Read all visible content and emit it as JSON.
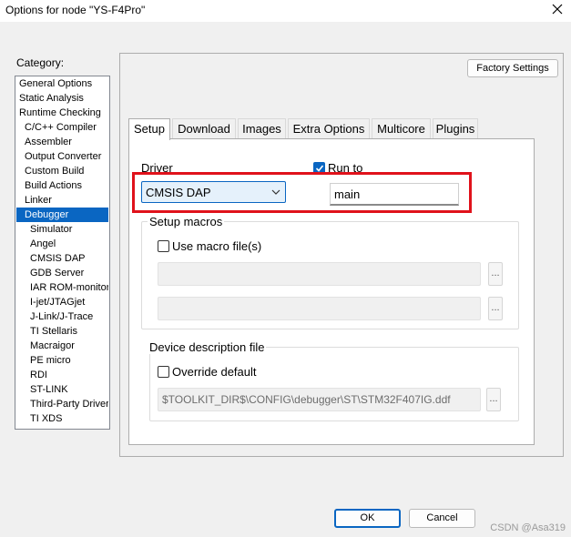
{
  "window": {
    "title": "Options for node \"YS-F4Pro\""
  },
  "category": {
    "label": "Category:",
    "items": [
      {
        "label": "General Options",
        "level": 0
      },
      {
        "label": "Static Analysis",
        "level": 0
      },
      {
        "label": "Runtime Checking",
        "level": 0
      },
      {
        "label": "C/C++ Compiler",
        "level": 1
      },
      {
        "label": "Assembler",
        "level": 1
      },
      {
        "label": "Output Converter",
        "level": 1
      },
      {
        "label": "Custom Build",
        "level": 1
      },
      {
        "label": "Build Actions",
        "level": 1
      },
      {
        "label": "Linker",
        "level": 1
      },
      {
        "label": "Debugger",
        "level": 1,
        "selected": true
      },
      {
        "label": "Simulator",
        "level": 2
      },
      {
        "label": "Angel",
        "level": 2
      },
      {
        "label": "CMSIS DAP",
        "level": 2
      },
      {
        "label": "GDB Server",
        "level": 2
      },
      {
        "label": "IAR ROM-monitor",
        "level": 2
      },
      {
        "label": "I-jet/JTAGjet",
        "level": 2
      },
      {
        "label": "J-Link/J-Trace",
        "level": 2
      },
      {
        "label": "TI Stellaris",
        "level": 2
      },
      {
        "label": "Macraigor",
        "level": 2
      },
      {
        "label": "PE micro",
        "level": 2
      },
      {
        "label": "RDI",
        "level": 2
      },
      {
        "label": "ST-LINK",
        "level": 2
      },
      {
        "label": "Third-Party Driver",
        "level": 2
      },
      {
        "label": "TI XDS",
        "level": 2
      }
    ]
  },
  "factory_settings": "Factory Settings",
  "tabs": [
    "Setup",
    "Download",
    "Images",
    "Extra Options",
    "Multicore",
    "Plugins"
  ],
  "active_tab": "Setup",
  "setup": {
    "driver_label": "Driver",
    "driver_value": "CMSIS DAP",
    "run_to_label": "Run to",
    "run_to_checked": true,
    "run_to_value": "main",
    "macros_title": "Setup macros",
    "use_macro_label": "Use macro file(s)",
    "use_macro_checked": false,
    "device_desc_title": "Device description file",
    "override_label": "Override default",
    "override_checked": false,
    "device_desc_path": "$TOOLKIT_DIR$\\CONFIG\\debugger\\ST\\STM32F407IG.ddf",
    "browse": "..."
  },
  "buttons": {
    "ok": "OK",
    "cancel": "Cancel"
  },
  "watermark": "CSDN @Asa319",
  "colors": {
    "accent": "#0a66c2",
    "highlight": "#e0121b"
  }
}
